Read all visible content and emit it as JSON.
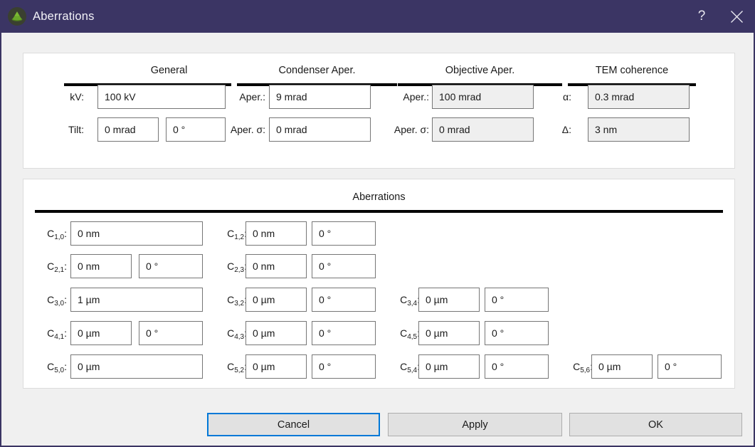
{
  "window": {
    "title": "Aberrations",
    "icon": "cone-icon",
    "help_label": "?",
    "close_label": "✕",
    "titlebar_color": "#3b3564",
    "accent_color": "#0078d7"
  },
  "top_panel": {
    "sections": [
      {
        "title": "General",
        "fields": [
          {
            "label": "kV:",
            "value": "100 kV",
            "disabled": false
          },
          {
            "label": "Tilt:",
            "value": "0 mrad",
            "disabled": false
          },
          {
            "label": "",
            "value": "0 °",
            "disabled": false
          }
        ]
      },
      {
        "title": "Condenser Aper.",
        "fields": [
          {
            "label": "Aper.:",
            "value": "9 mrad",
            "disabled": false
          },
          {
            "label": "Aper. σ:",
            "value": "0 mrad",
            "disabled": false
          }
        ]
      },
      {
        "title": "Objective Aper.",
        "fields": [
          {
            "label": "Aper.:",
            "value": "100 mrad",
            "disabled": true
          },
          {
            "label": "Aper. σ:",
            "value": "0 mrad",
            "disabled": true
          }
        ]
      },
      {
        "title": "TEM coherence",
        "fields": [
          {
            "label": "α:",
            "value": "0.3 mrad",
            "disabled": true
          },
          {
            "label": "Δ:",
            "value": "3 nm",
            "disabled": true
          }
        ]
      }
    ]
  },
  "aberrations_panel": {
    "title": "Aberrations",
    "rows": [
      {
        "groups": [
          {
            "sub": "1,0",
            "mag": "0 nm",
            "ang": null
          },
          {
            "sub": "1,2",
            "mag": "0 nm",
            "ang": "0 °"
          }
        ]
      },
      {
        "groups": [
          {
            "sub": "2,1",
            "mag": "0 nm",
            "ang": "0 °"
          },
          {
            "sub": "2,3",
            "mag": "0 nm",
            "ang": "0 °"
          }
        ]
      },
      {
        "groups": [
          {
            "sub": "3,0",
            "mag": "1 µm",
            "ang": null
          },
          {
            "sub": "3,2",
            "mag": "0 µm",
            "ang": "0 °"
          },
          {
            "sub": "3,4",
            "mag": "0 µm",
            "ang": "0 °"
          }
        ]
      },
      {
        "groups": [
          {
            "sub": "4,1",
            "mag": "0 µm",
            "ang": "0 °"
          },
          {
            "sub": "4,3",
            "mag": "0 µm",
            "ang": "0 °"
          },
          {
            "sub": "4,5",
            "mag": "0 µm",
            "ang": "0 °"
          }
        ]
      },
      {
        "groups": [
          {
            "sub": "5,0",
            "mag": "0 µm",
            "ang": null
          },
          {
            "sub": "5,2",
            "mag": "0 µm",
            "ang": "0 °"
          },
          {
            "sub": "5,4",
            "mag": "0 µm",
            "ang": "0 °"
          },
          {
            "sub": "5,6",
            "mag": "0 µm",
            "ang": "0 °"
          }
        ]
      }
    ]
  },
  "buttons": {
    "cancel": "Cancel",
    "apply": "Apply",
    "ok": "OK",
    "focused": "cancel"
  }
}
